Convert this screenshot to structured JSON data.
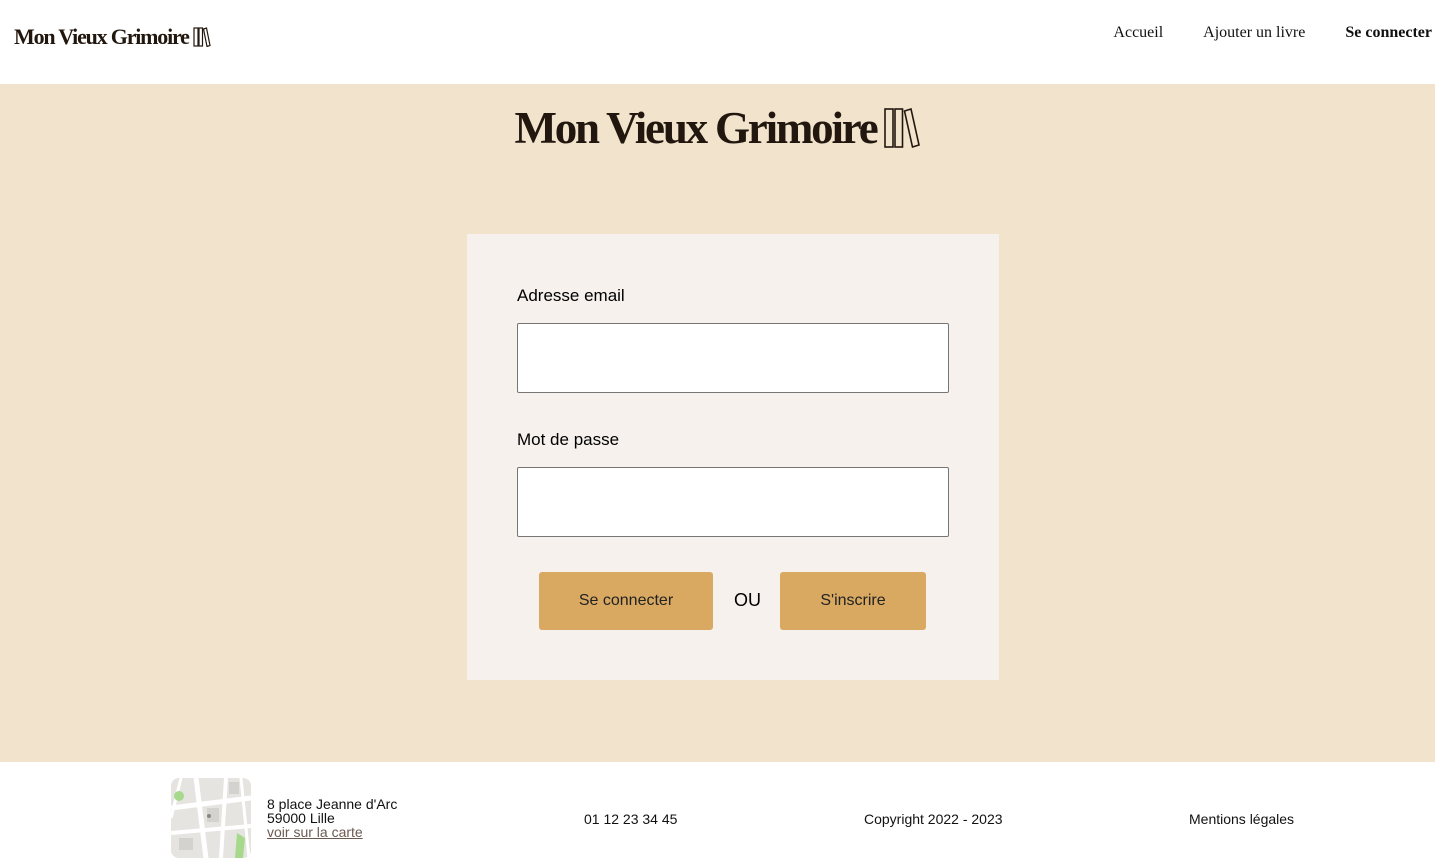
{
  "header": {
    "brand": "Mon Vieux Grimoire",
    "nav": [
      {
        "label": "Accueil"
      },
      {
        "label": "Ajouter un livre"
      },
      {
        "label": "Se connecter"
      }
    ]
  },
  "hero": {
    "brand": "Mon Vieux Grimoire"
  },
  "login_form": {
    "email_label": "Adresse email",
    "email_value": "",
    "password_label": "Mot de passe",
    "password_value": "",
    "login_button": "Se connecter",
    "or_text": "OU",
    "signup_button": "S'inscrire"
  },
  "footer": {
    "address_line1": "8 place Jeanne d'Arc",
    "address_line2": "59000 Lille",
    "map_link": "voir sur la carte",
    "phone": "01 12 23 34 45",
    "copyright": "Copyright 2022 - 2023",
    "legal": "Mentions légales"
  },
  "icons": {
    "logo": "books-icon",
    "map": "map-thumbnail"
  },
  "colors": {
    "background_main": "#f1e3cc",
    "card": "#f6f1ec",
    "button": "#d9a962",
    "brand_text": "#22170e"
  }
}
